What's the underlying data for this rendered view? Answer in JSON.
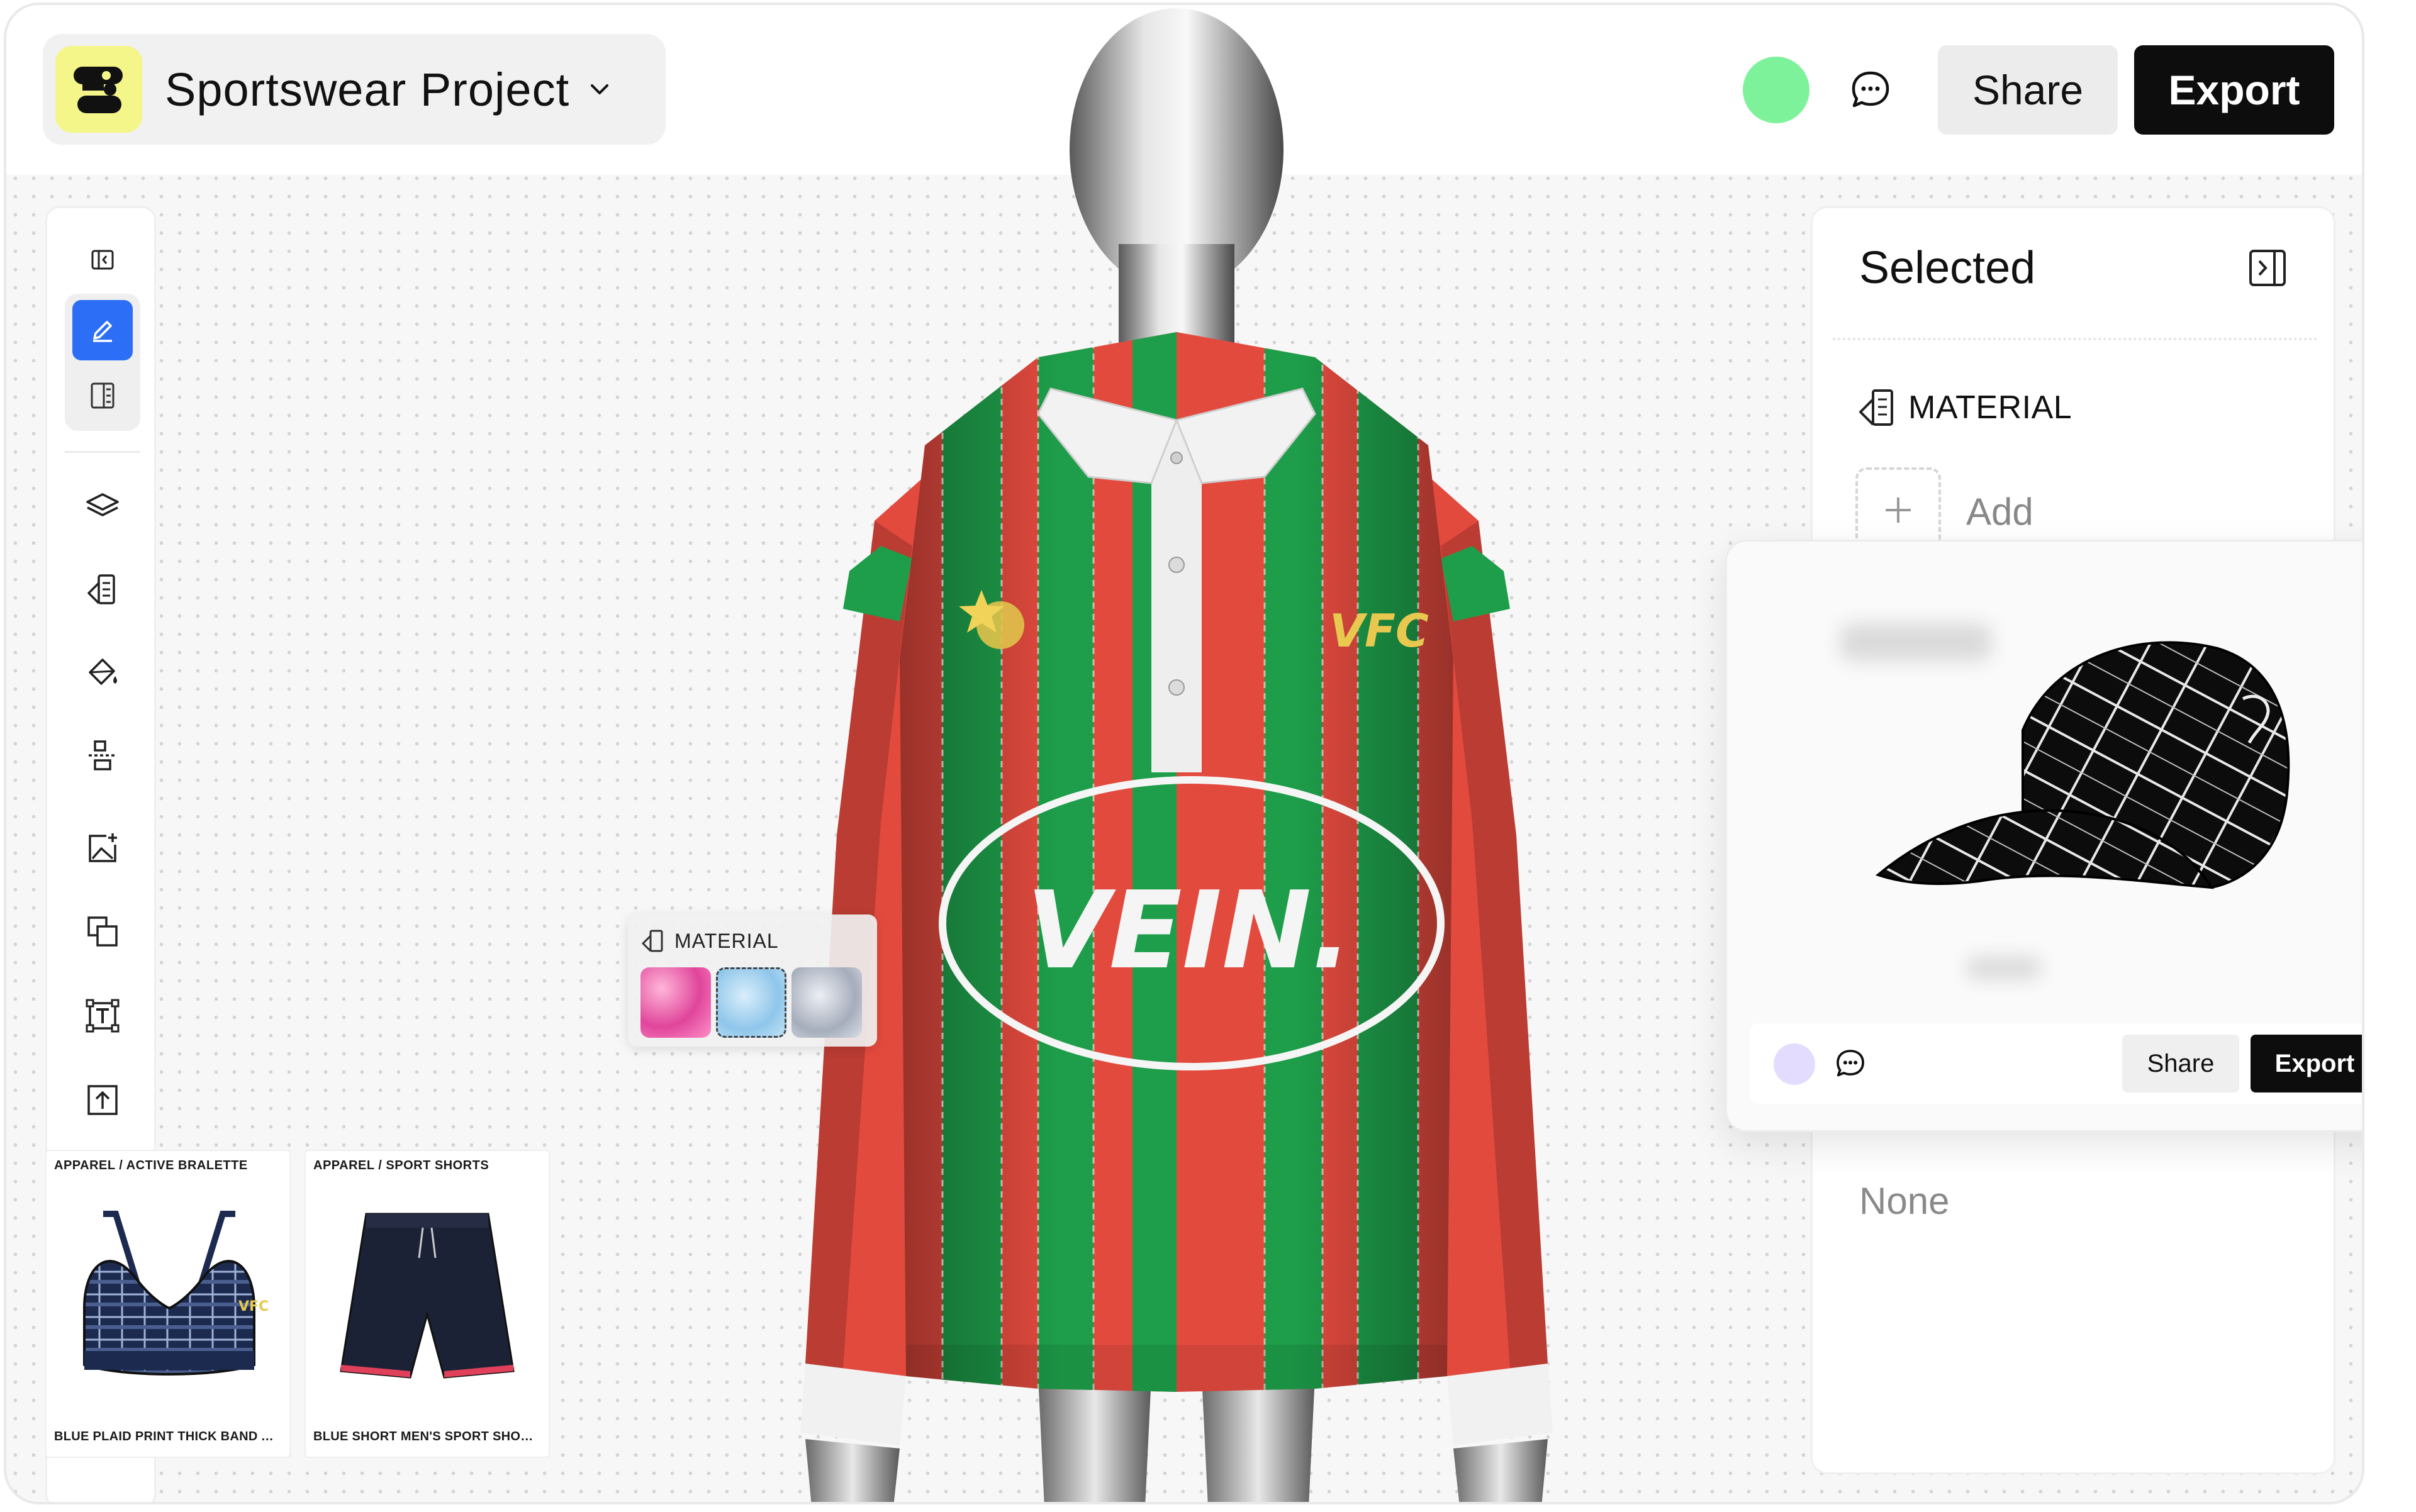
{
  "header": {
    "project_name": "Sportswear Project",
    "share_label": "Share",
    "export_label": "Export"
  },
  "toolbar": {
    "tools": [
      "collapse-sidebar-icon",
      "pen-icon",
      "panel-icon",
      "layers-icon",
      "material-book-icon",
      "paint-bucket-icon",
      "align-icon",
      "add-image-icon",
      "duplicate-icon",
      "text-frame-icon",
      "upload-icon"
    ],
    "active_tool": "pen-icon"
  },
  "canvas": {
    "garment": {
      "chest_badge": "VFC",
      "center_logo": "VEIN.",
      "stripe_colors": [
        "#e8453c",
        "#1e9e4a"
      ]
    },
    "material_popover": {
      "title": "MATERIAL",
      "swatches": [
        "pink-silk",
        "blue-tulle",
        "grey-chiffon"
      ]
    }
  },
  "products": [
    {
      "category": "APPAREL / ACTIVE BRALETTE",
      "name": "BLUE PLAID PRINT THICK BAND ACTIV..."
    },
    {
      "category": "APPAREL / SPORT SHORTS",
      "name": "BLUE SHORT MEN'S SPORT SHORTS"
    }
  ],
  "right_panel": {
    "title": "Selected",
    "material_heading": "MATERIAL",
    "add_label": "Add",
    "none_label": "None"
  },
  "preview_card": {
    "share_label": "Share",
    "export_label": "Export"
  },
  "colors": {
    "accent": "#2c6ff6",
    "presence_green": "#7ef29a",
    "logo_yellow": "#f4f689"
  }
}
